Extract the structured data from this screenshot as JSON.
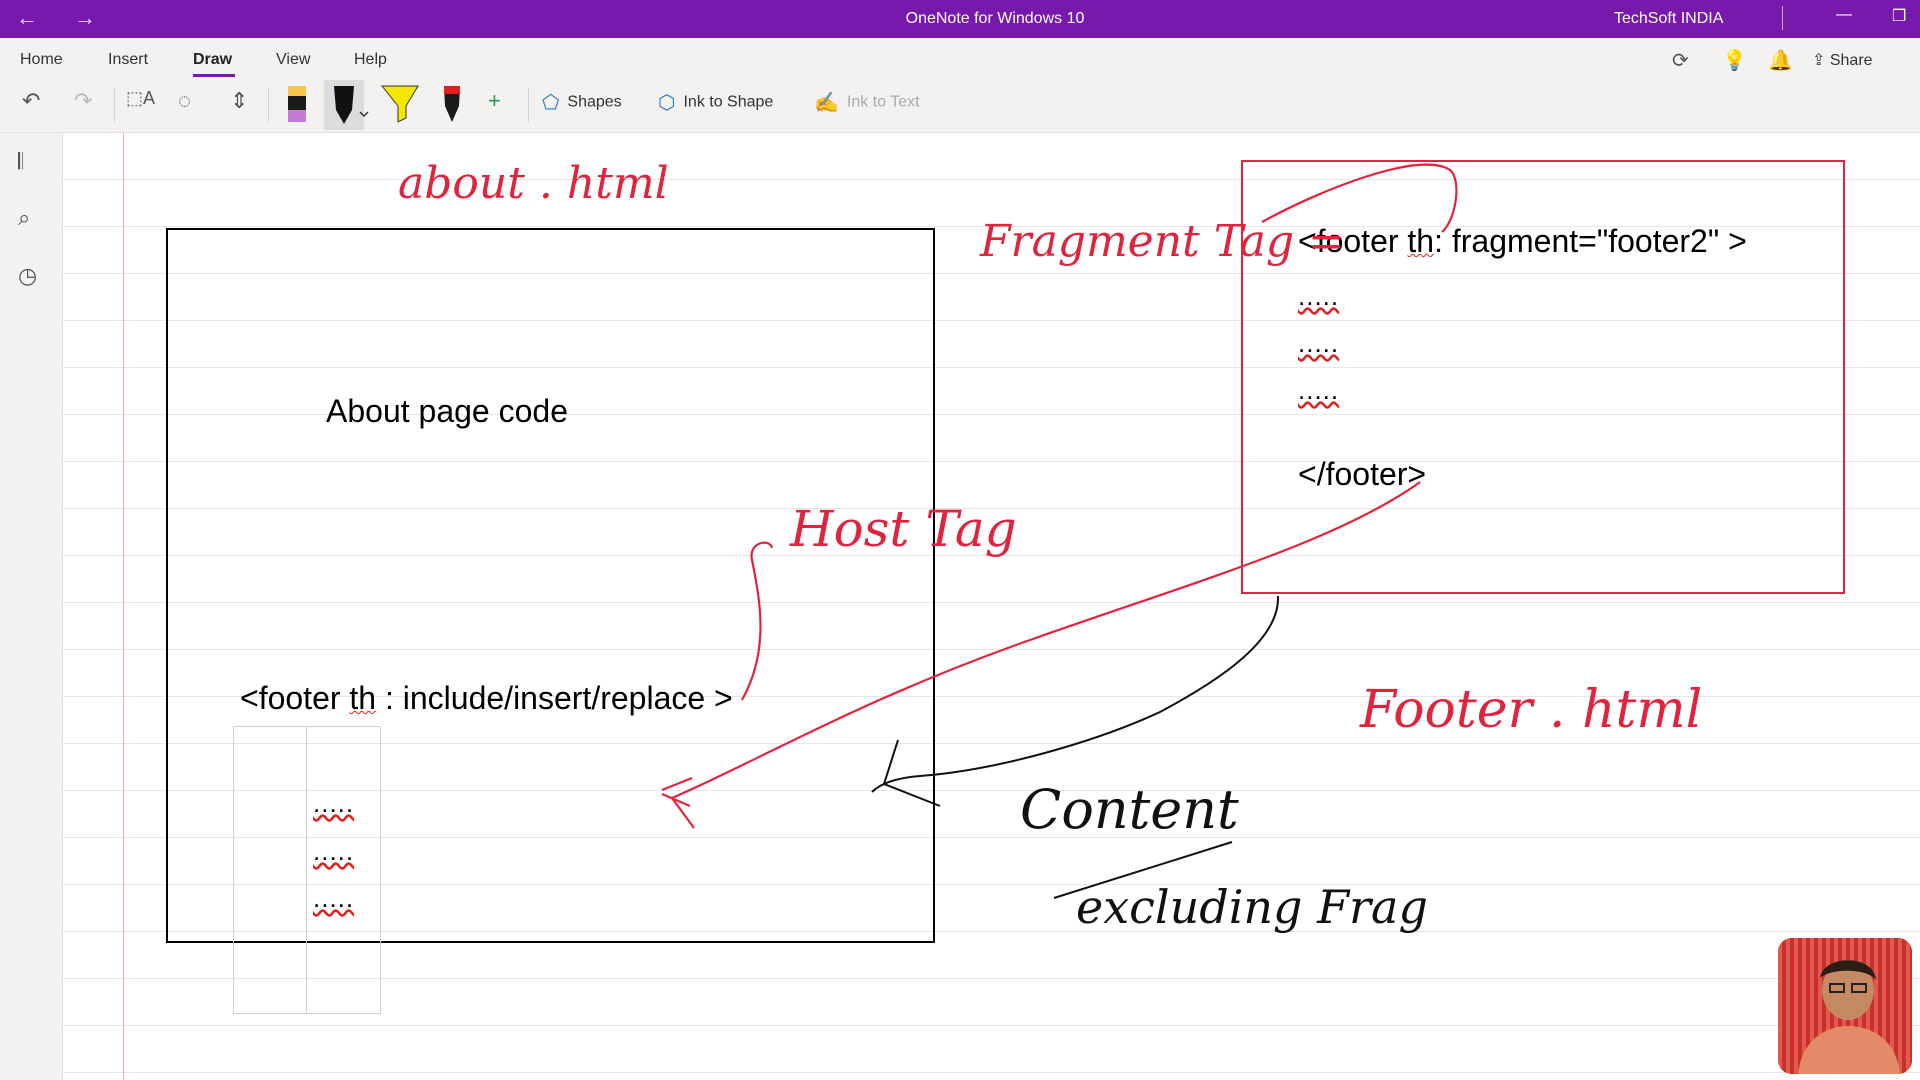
{
  "window": {
    "title": "OneNote for Windows 10",
    "user": "TechSoft INDIA",
    "back": "←",
    "forward": "→",
    "minimize": "—",
    "restore": "❐"
  },
  "ribbon": {
    "tabs": [
      "Home",
      "Insert",
      "Draw",
      "View",
      "Help"
    ],
    "active_tab": "Draw",
    "share_label": "Share",
    "shapes_label": "Shapes",
    "ink_to_shape_label": "Ink to Shape",
    "ink_to_text_label": "Ink to Text"
  },
  "page": {
    "about_code": "About page code",
    "host_tag_code": "<footer th : include/insert/replace >",
    "host_dots": [
      ".....",
      ".....",
      "....."
    ],
    "fragment_open": "<footer th: fragment=\"footer2\" >",
    "fragment_dots": [
      ".....",
      ".....",
      "....."
    ],
    "fragment_close": "</footer>"
  },
  "ink": {
    "about_html": "about . html",
    "fragment_tag": "Fragment Tag =",
    "host_tag": "Host Tag",
    "footer_html": "Footer . html",
    "content": "Content",
    "excluding": "excluding Frag"
  },
  "colors": {
    "accent": "#7719aa",
    "ink_red": "#e1243d",
    "ink_black": "#111111"
  }
}
